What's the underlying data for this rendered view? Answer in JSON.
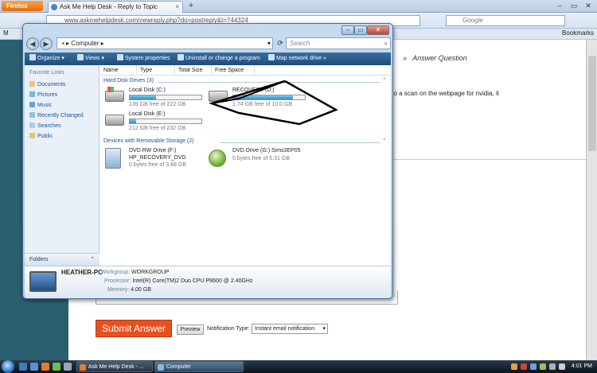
{
  "firefox": {
    "button_label": "Firefox",
    "tab_title": "Ask Me Help Desk - Reply to Topic",
    "url": "www.askmehelpdesk.com/newreply.php?do=postreply&t=744324",
    "search_placeholder": "Google",
    "bookmarks_label": "Bookmarks",
    "bm_m": "M"
  },
  "page": {
    "breadcrumb_sep": "»",
    "breadcrumb_current": "Answer Question",
    "snippet": "do a scan on the webpage for nvidia, it",
    "submit_label": "Submit Answer",
    "preview_label": "Preview",
    "notification_label": "Notification Type:",
    "notification_value": "Instant email notification"
  },
  "explorer": {
    "address": "Computer",
    "search_placeholder": "Search",
    "toolbar": {
      "organize": "Organize",
      "views": "Views",
      "system_properties": "System properties",
      "uninstall": "Uninstall or change a program",
      "map_drive": "Map network drive"
    },
    "sidebar": {
      "heading": "Favorite Links",
      "links": [
        "Documents",
        "Pictures",
        "Music",
        "Recently Changed",
        "Searches",
        "Public"
      ],
      "folders_label": "Folders"
    },
    "columns": [
      "Name",
      "Type",
      "Total Size",
      "Free Space"
    ],
    "hard_disk_group": "Hard Disk Drives (3)",
    "removable_group": "Devices with Removable Storage (2)",
    "drives": [
      {
        "name": "Local Disk (C:)",
        "free": "139 GB free of 222 GB",
        "used_fraction": 0.37
      },
      {
        "name": "RECOVERY (D:)",
        "free": "1.74 GB free of 10.0 GB",
        "used_fraction": 0.83
      },
      {
        "name": "Local Disk (E:)",
        "free": "212 GB free of 232 GB",
        "used_fraction": 0.09
      }
    ],
    "removable": [
      {
        "name": "DVD RW Drive (F:)",
        "label": "HP_RECOVERY_DVD",
        "free": "0 bytes free of 3.88 GB"
      },
      {
        "name": "DVD Drive (G:) Sims3EP05",
        "free": "0 bytes free of 5.31 GB"
      }
    ],
    "details": {
      "pc_name": "HEATHER-PC",
      "workgroup_key": "Workgroup:",
      "workgroup_val": "WORKGROUP",
      "processor_key": "Processor:",
      "processor_val": "Intel(R) Core(TM)2 Duo CPU     P8600  @ 2.40GHz",
      "memory_key": "Memory:",
      "memory_val": "4.00 GB"
    }
  },
  "taskbar": {
    "task1": "Ask Me Help Desk - ...",
    "task2": "Computer",
    "clock": "4:01 PM"
  }
}
